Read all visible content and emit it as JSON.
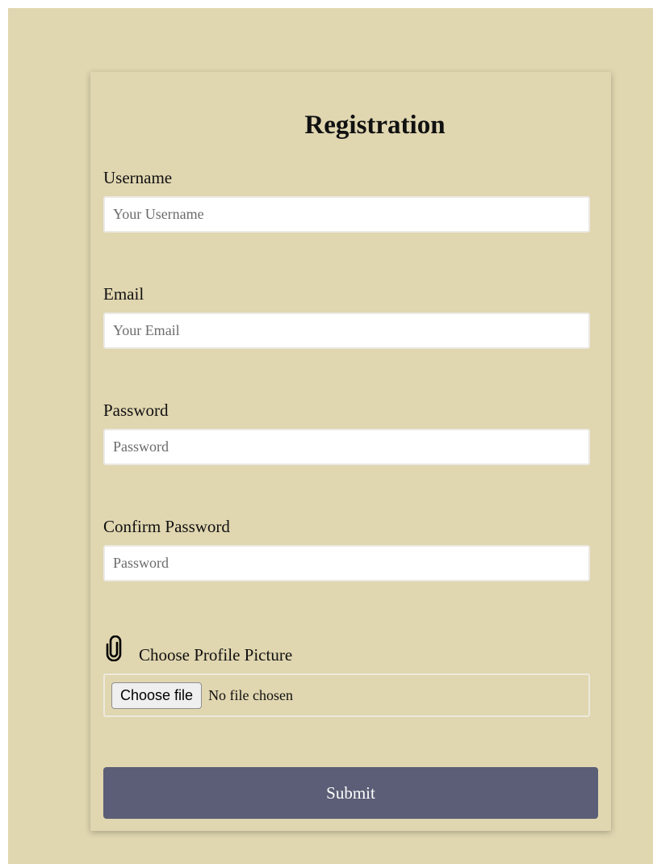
{
  "form": {
    "title": "Registration",
    "username": {
      "label": "Username",
      "placeholder": "Your Username",
      "value": ""
    },
    "email": {
      "label": "Email",
      "placeholder": "Your Email",
      "value": ""
    },
    "password": {
      "label": "Password",
      "placeholder": "Password",
      "value": ""
    },
    "confirm_password": {
      "label": "Confirm Password",
      "placeholder": "Password",
      "value": ""
    },
    "profile_picture": {
      "icon": "paperclip-icon",
      "label": "Choose Profile Picture",
      "button_label": "Choose file",
      "status": "No file chosen"
    },
    "submit_label": "Submit"
  },
  "colors": {
    "page_background": "#e0d6b0",
    "card_background": "#e0d6b0",
    "input_background": "#ffffff",
    "submit_background": "#5b5e76",
    "submit_text": "#ffffff"
  }
}
